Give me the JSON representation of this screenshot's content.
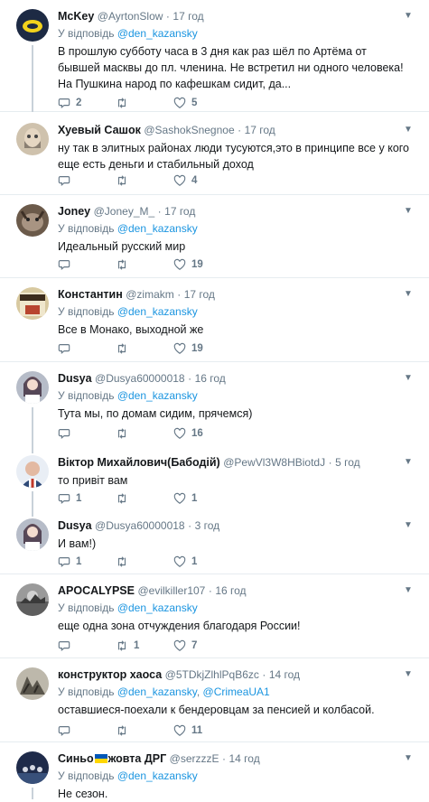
{
  "reply_prefix": "У відповідь",
  "tweets": [
    {
      "name": "McKey",
      "handle": "@AyrtonSlow",
      "dot": "·",
      "time": "17 год",
      "reply_to": "@den_kazansky",
      "text": "В прошлую субботу часа в 3 дня как раз шёл по Артёма от бывшей масквы до пл. членина. Не встретил ни одного человека! На Пушкина народ по кафешкам сидит, да...",
      "replies": "2",
      "retweets": "",
      "likes": "5"
    },
    {
      "name": "Хуевый Сашок",
      "handle": "@SashokSnegnoe",
      "dot": "·",
      "time": "17 год",
      "text": "ну так в элитных районах люди тусуются,это в принципе все у кого еще есть деньги и стабильный доход",
      "replies": "",
      "retweets": "",
      "likes": "4"
    },
    {
      "name": "Joney",
      "handle": "@Joney_M_",
      "dot": "·",
      "time": "17 год",
      "reply_to": "@den_kazansky",
      "text": "Идеальный русский мир",
      "replies": "",
      "retweets": "",
      "likes": "19"
    },
    {
      "name": "Константин",
      "handle": "@zimakm",
      "dot": "·",
      "time": "17 год",
      "reply_to": "@den_kazansky",
      "text": "Все в Монако, выходной же",
      "replies": "",
      "retweets": "",
      "likes": "19"
    },
    {
      "name": "Dusya",
      "handle": "@Dusya60000018",
      "dot": "·",
      "time": "16 год",
      "reply_to": "@den_kazansky",
      "text": "Тута мы, по домам сидим, прячемся)",
      "replies": "",
      "retweets": "",
      "likes": "16"
    },
    {
      "name": "Віктор Михайлович(Бабодій)",
      "handle": "@PewVl3W8HBiotdJ",
      "dot": "·",
      "time": "5 год",
      "text": "то привіт вам",
      "replies": "1",
      "retweets": "",
      "likes": "1"
    },
    {
      "name": "Dusya",
      "handle": "@Dusya60000018",
      "dot": "·",
      "time": "3 год",
      "text": "И вам!)",
      "replies": "1",
      "retweets": "",
      "likes": "1"
    },
    {
      "name": "APOCALYPSE",
      "handle": "@evilkiller107",
      "dot": "·",
      "time": "16 год",
      "reply_to": "@den_kazansky",
      "text": "еще одна зона отчуждения благодаря России!",
      "replies": "",
      "retweets": "1",
      "likes": "7"
    },
    {
      "name": "конструктор хаоса",
      "handle": "@5TDkjZlhlPqB6zc",
      "dot": "·",
      "time": "14 год",
      "reply_to": "@den_kazansky",
      "reply_to_2": "@CrimeaUA1",
      "reply_joiner": ",",
      "text": "оставшиеся-поехали к бендеровцам за пенсией и колбасой.",
      "replies": "",
      "retweets": "",
      "likes": "11"
    },
    {
      "name_a": "Синьо",
      "name_b": "жовта ДРГ",
      "handle": "@serzzzE",
      "dot": "·",
      "time": "14 год",
      "reply_to": "@den_kazansky",
      "text": "Не сезон.",
      "replies": "",
      "retweets": "",
      "likes": ""
    }
  ],
  "icons": {
    "reply": "reply-icon",
    "retweet": "retweet-icon",
    "like": "heart-icon",
    "caret": "chevron-down-icon"
  },
  "colors": {
    "link": "#1b95e0",
    "muted": "#657786",
    "divider": "#e6ecf0",
    "thread": "#c8d1d9",
    "flag_blue": "#0057b7",
    "flag_yellow": "#ffd700"
  }
}
